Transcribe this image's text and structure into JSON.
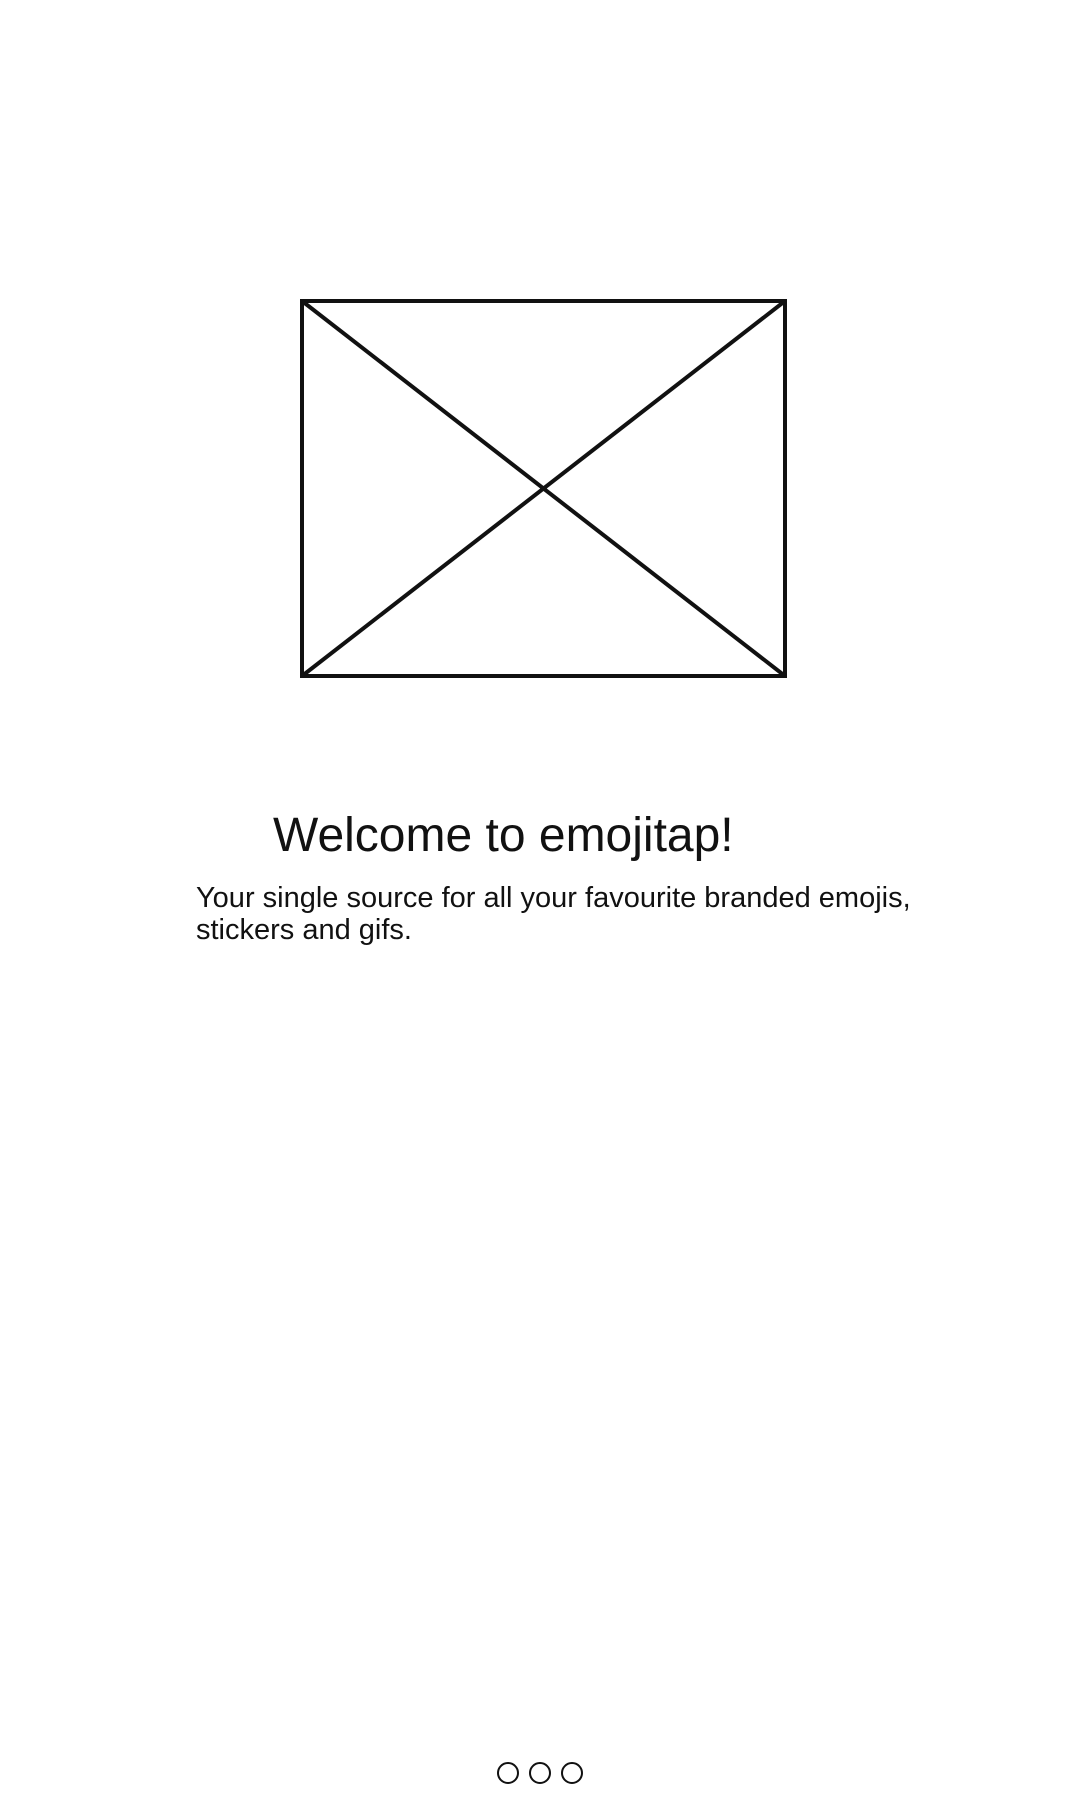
{
  "onboarding": {
    "title": "Welcome to emojitap!",
    "subtitle": "Your single source for all your favourite branded emojis, stickers and gifs.",
    "hero_icon": "image-placeholder-icon",
    "pager": {
      "total_pages": 3
    }
  }
}
